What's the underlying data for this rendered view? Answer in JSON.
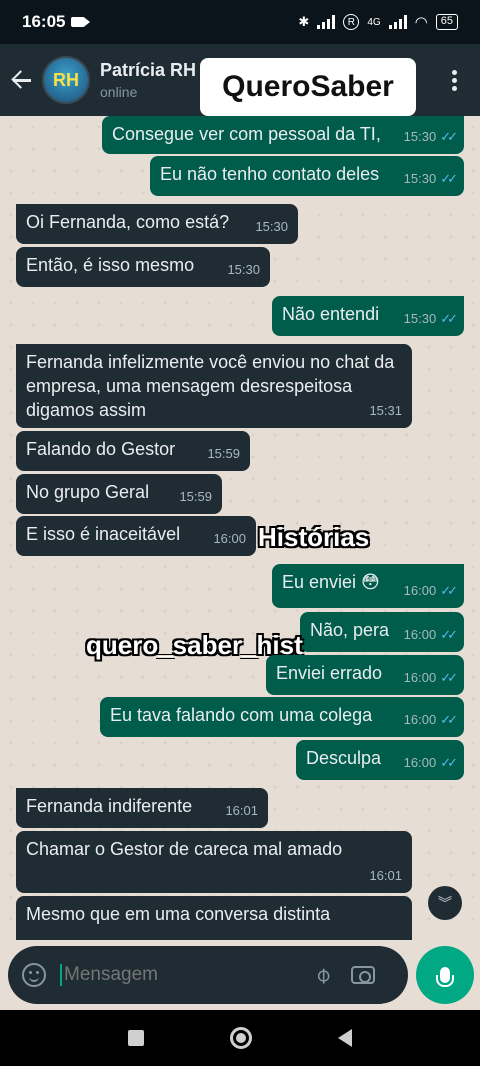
{
  "status_bar": {
    "time": "16:05",
    "network": "4G",
    "battery": "65",
    "r_symbol": "R"
  },
  "header": {
    "name": "Patrícia RH",
    "status": "online",
    "avatar_text": "RH",
    "overlay_brand": "QueroSaber"
  },
  "messages": [
    {
      "dir": "out",
      "text": "Consegue ver com pessoal da TI,",
      "time": "15:30",
      "ticks": "✓✓"
    },
    {
      "dir": "out",
      "text": "Eu não tenho contato deles",
      "time": "15:30",
      "ticks": "✓✓"
    },
    {
      "dir": "in",
      "text": "Oi Fernanda, como está?",
      "time": "15:30"
    },
    {
      "dir": "in",
      "text": "Então, é isso mesmo",
      "time": "15:30"
    },
    {
      "dir": "out",
      "text": "Não entendi",
      "time": "15:30",
      "ticks": "✓✓"
    },
    {
      "dir": "in",
      "text": "Fernanda infelizmente você enviou no chat da empresa, uma mensagem desrespeitosa digamos assim",
      "time": "15:31"
    },
    {
      "dir": "in",
      "text": "Falando do Gestor",
      "time": "15:59"
    },
    {
      "dir": "in",
      "text": "No grupo Geral",
      "time": "15:59"
    },
    {
      "dir": "in",
      "text": "E isso é inaceitável",
      "time": "16:00"
    },
    {
      "dir": "out",
      "text": "Eu enviei 😳",
      "time": "16:00",
      "ticks": "✓✓"
    },
    {
      "dir": "out",
      "text": "Não, pera",
      "time": "16:00",
      "ticks": "✓✓"
    },
    {
      "dir": "out",
      "text": "Enviei errado",
      "time": "16:00",
      "ticks": "✓✓"
    },
    {
      "dir": "out",
      "text": "Eu tava falando com uma colega",
      "time": "16:00",
      "ticks": "✓✓"
    },
    {
      "dir": "out",
      "text": "Desculpa",
      "time": "16:00",
      "ticks": "✓✓"
    },
    {
      "dir": "in",
      "text": "Fernanda indiferente",
      "time": "16:01"
    },
    {
      "dir": "in",
      "text": "Chamar o Gestor de careca mal amado",
      "time": "16:01"
    },
    {
      "dir": "in",
      "text": "Mesmo que em uma conversa distinta",
      "time": ""
    }
  ],
  "watermarks": {
    "historias": "Histórias",
    "handle": "quero_saber_hist"
  },
  "input": {
    "placeholder": "Mensagem"
  },
  "icons": {
    "back": "arrow-left-icon",
    "menu": "more-vertical-icon",
    "emoji": "emoji-icon",
    "attach": "paperclip-icon",
    "camera": "camera-icon",
    "mic": "mic-icon",
    "scroll": "chevron-double-down-icon"
  },
  "colors": {
    "outgoing": "#005c4b",
    "incoming": "#202c33",
    "accent": "#00a884",
    "read_ticks": "#53bdeb"
  }
}
